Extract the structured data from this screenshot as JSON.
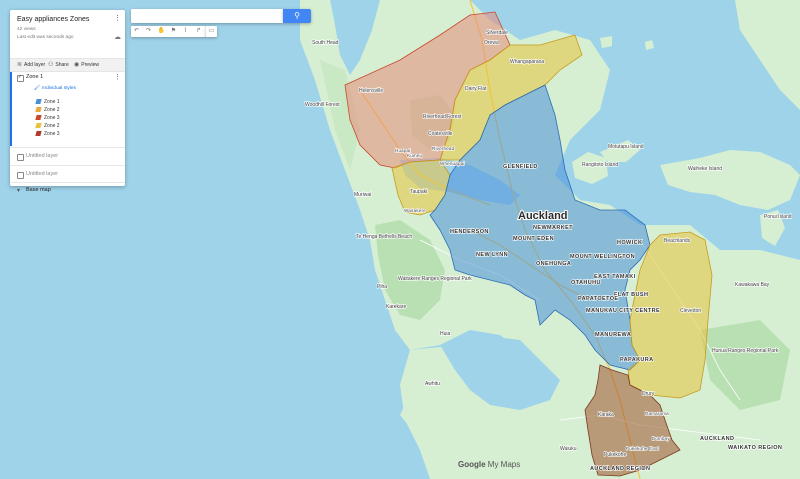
{
  "panel": {
    "title": "Easy appliances Zones",
    "views": "42 views",
    "last_edit": "Last edit was seconds ago",
    "actions": [
      {
        "label": "Add layer",
        "icon": "add-layer-icon"
      },
      {
        "label": "Share",
        "icon": "share-icon"
      },
      {
        "label": "Preview",
        "icon": "eye-icon"
      }
    ],
    "layers": [
      {
        "name": "Zone 1",
        "checked": true,
        "style_link": "Individual styles",
        "items": [
          {
            "label": "Zone 1",
            "color": "#4a90d9"
          },
          {
            "label": "Zone 2",
            "color": "#e8a93a"
          },
          {
            "label": "Zone 3",
            "color": "#c9472c"
          },
          {
            "label": "Zone 2",
            "color": "#e8c23a"
          },
          {
            "label": "Zone 3",
            "color": "#b03a2e"
          }
        ]
      },
      {
        "name": "Untitled layer",
        "checked": false
      },
      {
        "name": "Untitled layer",
        "checked": false
      }
    ],
    "base_map": "Base map"
  },
  "search": {
    "value": "",
    "placeholder": ""
  },
  "toolbar": {
    "tools": [
      "undo-icon",
      "redo-icon",
      "hand-icon",
      "marker-icon",
      "line-icon",
      "directions-icon"
    ],
    "ruler": "ruler-icon"
  },
  "branding": {
    "google": "Google",
    "product": "My Maps"
  },
  "colors": {
    "water": "#9fd3ea",
    "land": "#d4efd0",
    "zone1": "#4a90d9",
    "zone2": "#e8c23a",
    "zone3_red": "#e88a7a",
    "zone3_brown": "#a0522d"
  },
  "places": {
    "city": "Auckland",
    "suburbs": [
      "HENDERSON",
      "MOUNT EDEN",
      "NEW LYNN",
      "ONEHUNGA",
      "MOUNT WELLINGTON",
      "EAST TAMAKI",
      "FLAT BUSH",
      "PAPATOETOE",
      "MANUKAU CITY CENTRE",
      "MANUREWA",
      "PAPAKURA",
      "NEWMARKET",
      "HOWICK",
      "OTAHUHU",
      "GLENFIELD"
    ],
    "towns": [
      "Helensville",
      "Riverhead Forest",
      "Coatesville",
      "Dairy Flat",
      "Whangaparaoa",
      "Kumeu",
      "Huapai",
      "Riverhead",
      "Taupaki",
      "Waitakere",
      "Whenuapai",
      "Muriwai",
      "Te Henga Bethells Beach",
      "Piha",
      "Karekare",
      "Waitakere Ranges Regional Park",
      "Huia",
      "Awhitu",
      "Waiuku",
      "Clevedon",
      "Beachlands",
      "Drury",
      "Karaka",
      "Ramarama",
      "Pukekohe",
      "Bombay",
      "Pukekohe East",
      "Rangitoto Island",
      "Motutapu Island",
      "Waiheke Island",
      "Ponui Island",
      "Hunua Ranges Regional Park",
      "Kawakawa Bay",
      "Orewa",
      "Silverdale",
      "Woodhill Forest",
      "South Head"
    ],
    "regions": [
      "AUCKLAND",
      "WAIKATO REGION",
      "AUCKLAND REGION"
    ]
  }
}
